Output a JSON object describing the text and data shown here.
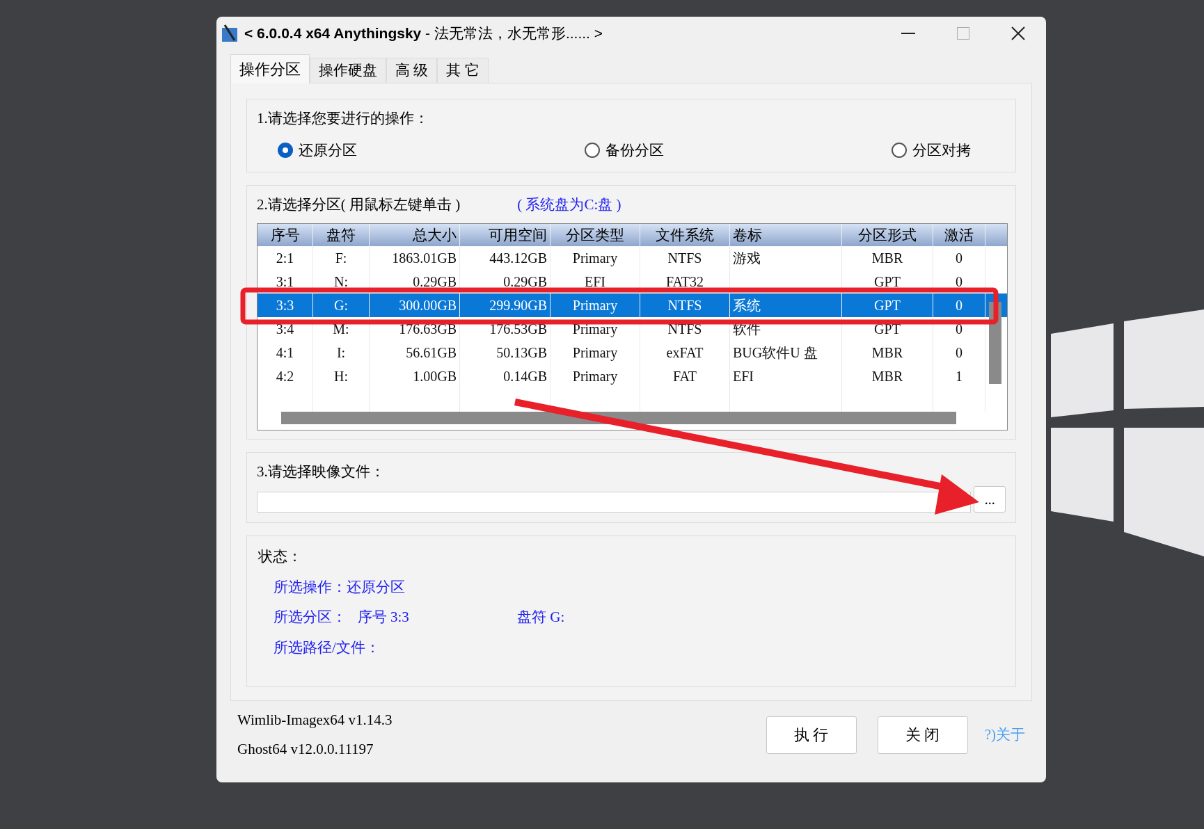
{
  "window": {
    "title": "**< 6.0.0.4 x64 Anythingsky** - 法无常法，水无常形...... >"
  },
  "tabs": [
    {
      "label": "操作分区",
      "selected": true
    },
    {
      "label": "操作硬盘",
      "selected": false
    },
    {
      "label": "高 级",
      "selected": false
    },
    {
      "label": "其 它",
      "selected": false
    }
  ],
  "operation": {
    "label": "1.请选择您要进行的操作：",
    "options": [
      {
        "label": "还原分区",
        "selected": true
      },
      {
        "label": "备份分区",
        "selected": false
      },
      {
        "label": "分区对拷",
        "selected": false
      }
    ]
  },
  "partition": {
    "label": "2.请选择分区( 用鼠标左键单击 )",
    "hint": "( 系统盘为C:盘 )",
    "table": {
      "columns": [
        "序号",
        "盘符",
        "总大小",
        "可用空间",
        "分区类型",
        "文件系统",
        "卷标",
        "分区形式",
        "激活"
      ],
      "rows": [
        {
          "cells": [
            "2:1",
            "F:",
            "1863.01GB",
            "443.12GB",
            "Primary",
            "NTFS",
            "游戏",
            "MBR",
            "0"
          ],
          "selected": false
        },
        {
          "cells": [
            "3:1",
            "N:",
            "0.29GB",
            "0.29GB",
            "EFI",
            "FAT32",
            "",
            "GPT",
            "0"
          ],
          "selected": false
        },
        {
          "cells": [
            "3:3",
            "G:",
            "300.00GB",
            "299.90GB",
            "Primary",
            "NTFS",
            "系统",
            "GPT",
            "0"
          ],
          "selected": true
        },
        {
          "cells": [
            "3:4",
            "M:",
            "176.63GB",
            "176.53GB",
            "Primary",
            "NTFS",
            "软件",
            "GPT",
            "0"
          ],
          "selected": false
        },
        {
          "cells": [
            "4:1",
            "I:",
            "56.61GB",
            "50.13GB",
            "Primary",
            "exFAT",
            "BUG软件U 盘",
            "MBR",
            "0"
          ],
          "selected": false
        },
        {
          "cells": [
            "4:2",
            "H:",
            "1.00GB",
            "0.14GB",
            "Primary",
            "FAT",
            "EFI",
            "MBR",
            "1"
          ],
          "selected": false
        }
      ]
    }
  },
  "image": {
    "label": "3.请选择映像文件：",
    "browse": "..."
  },
  "status": {
    "label": "状态：",
    "operation": "所选操作：还原分区",
    "partition": "所选分区：   序号 3:3",
    "drive": "盘符 G:",
    "path": "所选路径/文件："
  },
  "footer": {
    "versions": [
      "Wimlib-Imagex64 v1.14.3",
      "Ghost64 v12.0.0.11197"
    ],
    "buttons": [
      "执 行",
      "关 闭"
    ],
    "about": "?)关于"
  }
}
